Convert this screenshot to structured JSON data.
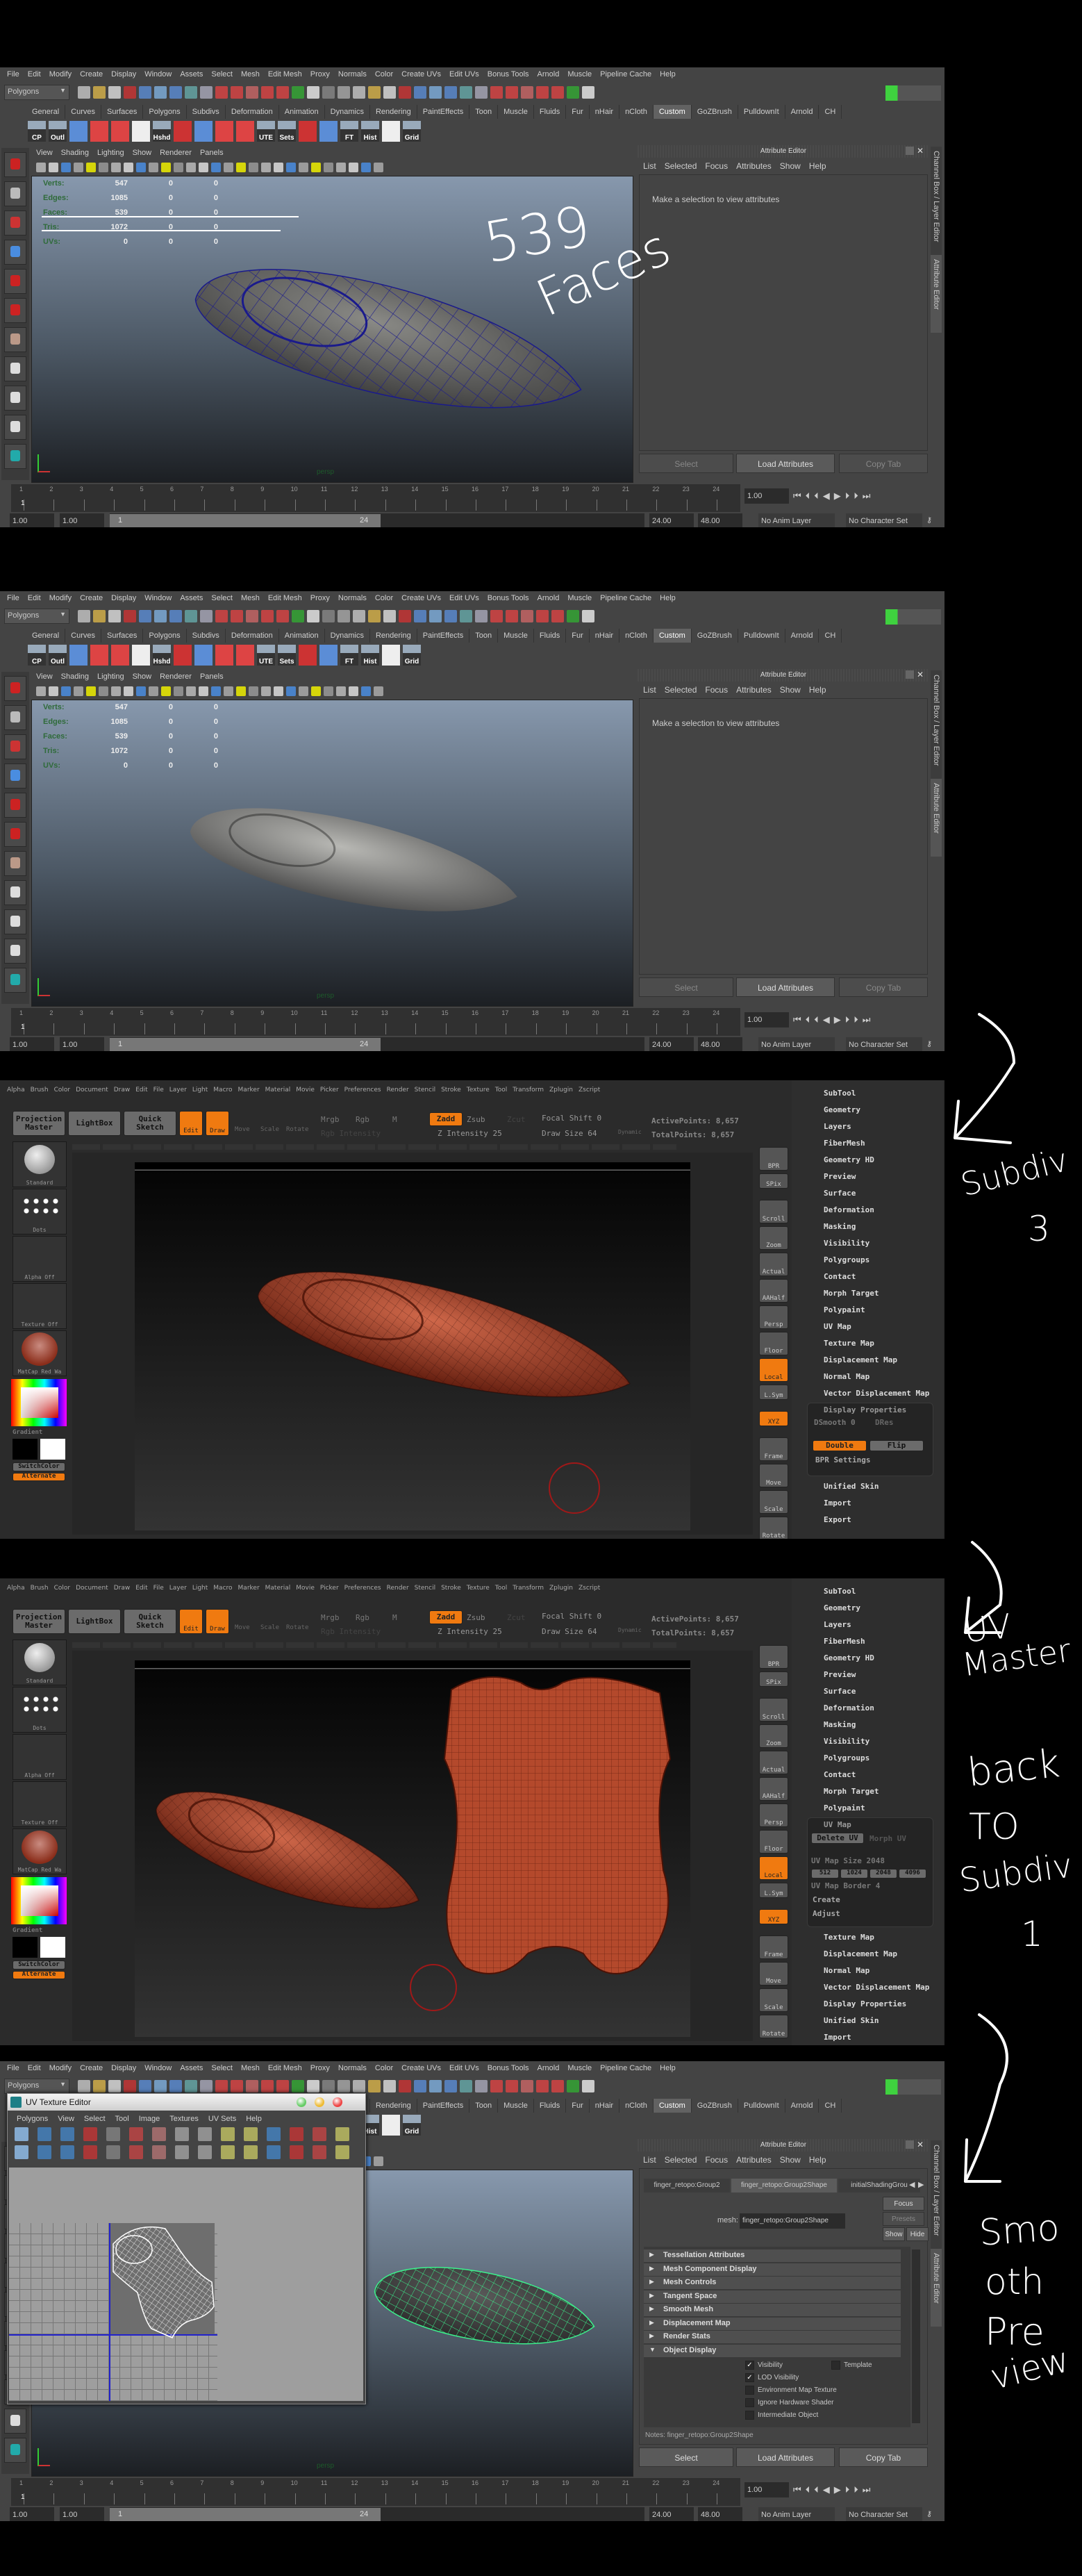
{
  "maya": {
    "menu": [
      "File",
      "Edit",
      "Modify",
      "Create",
      "Display",
      "Window",
      "Assets",
      "Select",
      "Mesh",
      "Edit Mesh",
      "Proxy",
      "Normals",
      "Color",
      "Create UVs",
      "Edit UVs",
      "Bonus Tools",
      "Arnold",
      "Muscle",
      "Pipeline Cache",
      "Help"
    ],
    "mode": "Polygons",
    "shelf_tabs": [
      "General",
      "Curves",
      "Surfaces",
      "Polygons",
      "Subdivs",
      "Deformation",
      "Animation",
      "Dynamics",
      "Rendering",
      "PaintEffects",
      "Toon",
      "Muscle",
      "Fluids",
      "Fur",
      "nHair",
      "nCloth",
      "Custom",
      "GoZBrush",
      "PulldownIt",
      "Arnold",
      "CH"
    ],
    "active_shelf": "Custom",
    "shelf_labels": [
      "CP",
      "Outl",
      "",
      "",
      "",
      "",
      "Hshd",
      "",
      "",
      "",
      "",
      "UTE",
      "Sets",
      "",
      "",
      "FT",
      "Hist",
      "",
      "Grid"
    ],
    "panel_menu": [
      "View",
      "Shading",
      "Lighting",
      "Show",
      "Renderer",
      "Panels"
    ],
    "hud_labels": [
      "Verts:",
      "Edges:",
      "Faces:",
      "Tris:",
      "UVs:"
    ],
    "camera": "persp",
    "timeline_ticks": [
      "1",
      "2",
      "3",
      "4",
      "5",
      "6",
      "7",
      "8",
      "9",
      "10",
      "11",
      "12",
      "13",
      "14",
      "15",
      "16",
      "17",
      "18",
      "19",
      "20",
      "21",
      "22",
      "23",
      "24"
    ],
    "current_frame": "1",
    "current_time": "1.00",
    "range": {
      "start": "1.00",
      "inner_start": "1.00",
      "slider_start": "1",
      "slider_end": "24",
      "end": "24.00",
      "outer_end": "48.00"
    },
    "anim_layer": "No Anim Layer",
    "char_set": "No Character Set",
    "side_tabs": [
      "Channel Box / Layer Editor",
      "Attribute Editor"
    ],
    "attr_editor": {
      "title": "Attribute Editor",
      "menu": [
        "List",
        "Selected",
        "Focus",
        "Attributes",
        "Show",
        "Help"
      ],
      "empty_message": "Make a selection to view attributes",
      "buttons": [
        "Select",
        "Load Attributes",
        "Copy Tab"
      ]
    }
  },
  "sections": {
    "s1": {
      "hud": [
        [
          "547",
          "0",
          "0"
        ],
        [
          "1085",
          "0",
          "0"
        ],
        [
          "539",
          "0",
          "0"
        ],
        [
          "1072",
          "0",
          "0"
        ],
        [
          "0",
          "0",
          "0"
        ]
      ],
      "note": [
        "539",
        "Faces"
      ]
    },
    "s2": {
      "hud": [
        [
          "547",
          "0",
          "0"
        ],
        [
          "1085",
          "0",
          "0"
        ],
        [
          "539",
          "0",
          "0"
        ],
        [
          "1072",
          "0",
          "0"
        ],
        [
          "0",
          "0",
          "0"
        ]
      ]
    },
    "s3": {
      "note": [
        "Subdiv",
        "3"
      ]
    },
    "s4": {
      "note": [
        "UV",
        "Master",
        "back",
        "TO",
        "Subdiv",
        "1"
      ]
    },
    "s5": {
      "note": [
        "Smo",
        "oth",
        "Pre",
        "view"
      ]
    }
  },
  "uv_editor": {
    "title": "UV Texture Editor",
    "menu": [
      "Polygons",
      "View",
      "Select",
      "Tool",
      "Image",
      "Textures",
      "UV Sets",
      "Help"
    ]
  },
  "attr_s5": {
    "tabs": [
      "finger_retopo:Group2",
      "finger_retopo:Group2Shape",
      "initialShadingGrou"
    ],
    "mesh_label": "mesh:",
    "mesh_value": "finger_retopo:Group2Shape",
    "side_buttons": [
      "Focus",
      "Presets",
      "Show",
      "Hide"
    ],
    "sections": [
      "Tessellation Attributes",
      "Mesh Component Display",
      "Mesh Controls",
      "Tangent Space",
      "Smooth Mesh",
      "Displacement Map",
      "Render Stats",
      "Object Display"
    ],
    "options": [
      {
        "label": "Visibility",
        "checked": true
      },
      {
        "label": "Template",
        "checked": false
      },
      {
        "label": "LOD Visibility",
        "checked": true
      },
      {
        "label": "Environment Map Texture",
        "checked": false
      },
      {
        "label": "Ignore Hardware Shader",
        "checked": false
      },
      {
        "label": "Intermediate Object",
        "checked": false
      }
    ],
    "notes": "Notes: finger_retopo:Group2Shape"
  },
  "zbrush": {
    "menu": [
      "Alpha",
      "Brush",
      "Color",
      "Document",
      "Draw",
      "Edit",
      "File",
      "Layer",
      "Light",
      "Macro",
      "Marker",
      "Material",
      "Movie",
      "Picker",
      "Preferences",
      "Render",
      "Stencil",
      "Stroke",
      "Texture",
      "Tool",
      "Transform",
      "Zplugin",
      "Zscript"
    ],
    "projection_master": "Projection Master",
    "lightbox": "LightBox",
    "quick_sketch": "Quick Sketch",
    "edit": "Edit",
    "draw": "Draw",
    "move": "Move",
    "scale": "Scale",
    "rotate": "Rotate",
    "mrgb": "Mrgb",
    "rgb": "Rgb",
    "m": "M",
    "zadd": "Zadd",
    "zsub": "Zsub",
    "zcut": "Zcut",
    "rgb_intensity": "Rgb Intensity",
    "z_intensity": "Z Intensity 25",
    "focal_shift": "Focal Shift 0",
    "draw_size": "Draw Size 64",
    "dynamic": "Dynamic",
    "active_points": "ActivePoints: 8,657",
    "total_points": "TotalPoints: 8,657",
    "tray": [
      "Standard",
      "Dots",
      "Alpha Off",
      "Texture Off",
      "MatCap Red Wa"
    ],
    "gradient": "Gradient",
    "switch_color": "SwitchColor",
    "alternate": "Alternate",
    "right_shelf": [
      "BPR",
      "SPix",
      "Scroll",
      "Zoom",
      "Actual",
      "AAHalf",
      "Persp",
      "Floor",
      "Local",
      "L.Sym",
      "XYZ",
      "Frame",
      "Move",
      "Scale",
      "Rotate"
    ],
    "palette_s3": {
      "items_top": [
        "SubTool",
        "Geometry",
        "Layers",
        "FiberMesh",
        "Geometry HD",
        "Preview",
        "Surface",
        "Deformation",
        "Masking",
        "Visibility",
        "Polygroups",
        "Contact",
        "Morph Target",
        "Polypaint",
        "UV Map",
        "Texture Map",
        "Displacement Map",
        "Normal Map",
        "Vector Displacement Map"
      ],
      "open": "Display Properties",
      "dsmooth": "DSmooth 0",
      "dres": "DRes",
      "double": "Double",
      "flip": "Flip",
      "bpr": "BPR Settings",
      "items_bottom": [
        "Unified Skin",
        "Import",
        "Export"
      ]
    },
    "palette_s4": {
      "items_top": [
        "SubTool",
        "Geometry",
        "Layers",
        "FiberMesh",
        "Geometry HD",
        "Preview",
        "Surface",
        "Deformation",
        "Masking",
        "Visibility",
        "Polygroups",
        "Contact",
        "Morph Target",
        "Polypaint"
      ],
      "open": "UV Map",
      "delete_uv": "Delete UV",
      "morph_uv": "Morph UV",
      "map_size": "UV Map Size 2048",
      "sizes": [
        "512",
        "1024",
        "2048",
        "4096"
      ],
      "border": "UV Map Border 4",
      "create": "Create",
      "adjust": "Adjust",
      "items_bottom": [
        "Texture Map",
        "Displacement Map",
        "Normal Map",
        "Vector Displacement Map",
        "Display Properties",
        "Unified Skin",
        "Import"
      ]
    }
  },
  "colors": {
    "maya_bg": "#444444",
    "zbrush_orange": "#f07a10",
    "mesh_red": "#a8391f",
    "wire_blue": "#1a1a8c",
    "wire_green": "#3cf08c",
    "active_shelf": "#626262"
  }
}
